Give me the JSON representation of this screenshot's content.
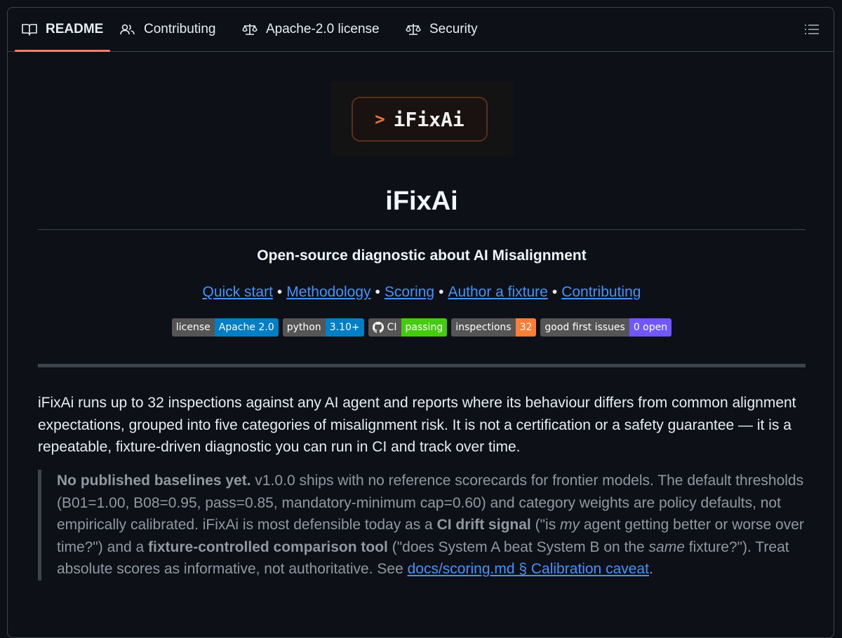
{
  "tabs": [
    {
      "label": "README",
      "icon": "book-icon",
      "active": true
    },
    {
      "label": "Contributing",
      "icon": "people-icon",
      "active": false
    },
    {
      "label": "Apache-2.0 license",
      "icon": "law-icon",
      "active": false
    },
    {
      "label": "Security",
      "icon": "law-icon",
      "active": false
    }
  ],
  "toc_icon": "list-unordered-icon",
  "logo": {
    "caret": ">",
    "name": "iFixAi",
    "accent": "#e6743d"
  },
  "title": "iFixAi",
  "tagline": "Open-source diagnostic about AI Misalignment",
  "links": [
    "Quick start",
    "Methodology",
    "Scoring",
    "Author a fixture",
    "Contributing"
  ],
  "link_separator": "•",
  "badges": [
    {
      "label": "license",
      "value": "Apache 2.0",
      "color": "#007ec6"
    },
    {
      "label": "python",
      "value": "3.10+",
      "color": "#007ec6"
    },
    {
      "label": "CI",
      "value": "passing",
      "color": "#4c1",
      "icon": "github-icon"
    },
    {
      "label": "inspections",
      "value": "32",
      "color": "#fe7d37"
    },
    {
      "label": "good first issues",
      "value": "0 open",
      "color": "#7057ff"
    }
  ],
  "intro": "iFixAi runs up to 32 inspections against any AI agent and reports where its behaviour differs from common alignment expectations, grouped into five categories of misalignment risk. It is not a certification or a safety guarantee — it is a repeatable, fixture-driven diagnostic you can run in CI and track over time.",
  "note": {
    "lead": "No published baselines yet.",
    "text1": " v1.0.0 ships with no reference scorecards for frontier models. The default thresholds (B01=1.00, B08=0.95, pass=0.85, mandatory-minimum cap=0.60) and category weights are policy defaults, not empirically calibrated. iFixAi is most defensible today as a ",
    "bold1": "CI drift signal",
    "text2": " (\"is ",
    "em1": "my",
    "text3": " agent getting better or worse over time?\") and a ",
    "bold2": "fixture-controlled comparison tool",
    "text4": " (\"does System A beat System B on the ",
    "em2": "same",
    "text5": " fixture?\"). Treat absolute scores as informative, not authoritative. See ",
    "link": "docs/scoring.md § Calibration caveat",
    "text6": "."
  },
  "colors": {
    "background": "#0d1117",
    "border": "#3d444d",
    "link": "#4493f8",
    "active_tab_underline": "#f78166",
    "muted_text": "#9198a1"
  }
}
